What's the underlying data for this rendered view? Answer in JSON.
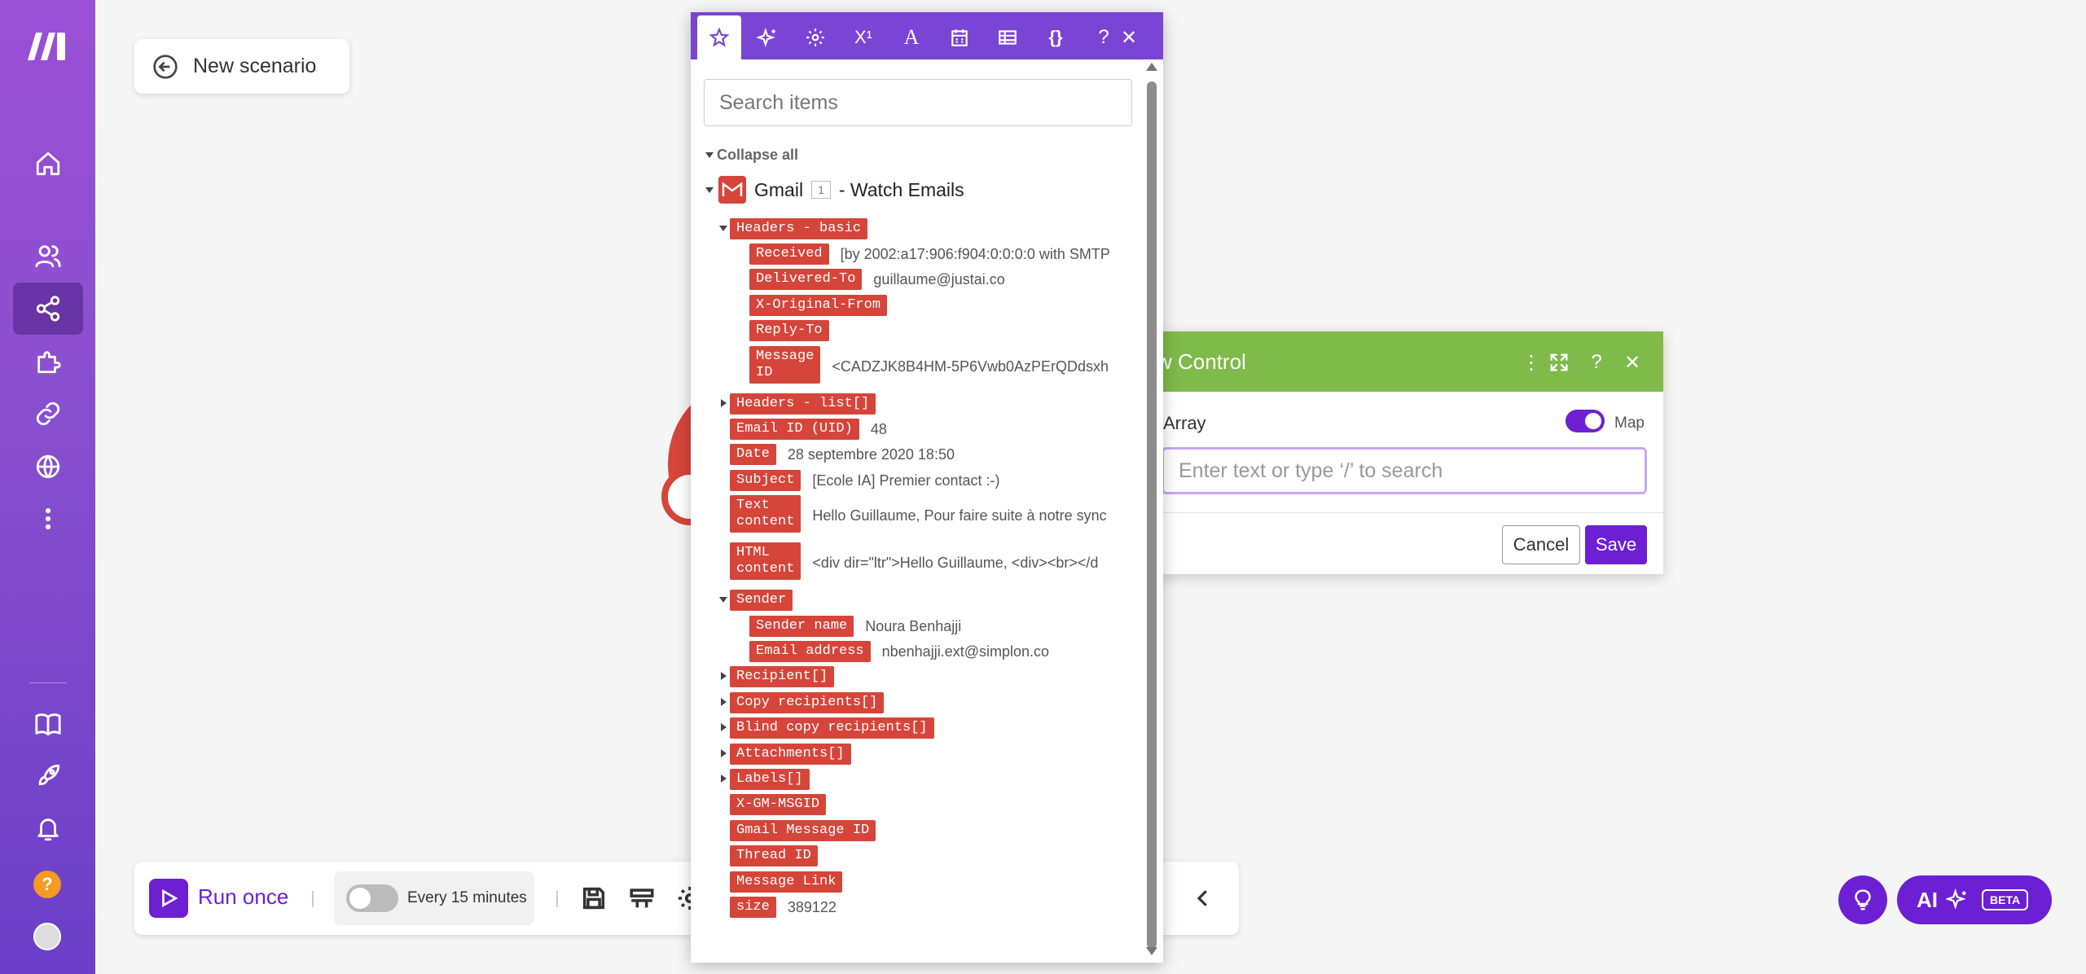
{
  "scenario": {
    "title": "New scenario"
  },
  "sidebar": {
    "items": [
      {
        "icon": "home-icon"
      },
      {
        "icon": "team-icon"
      },
      {
        "icon": "share-icon"
      },
      {
        "icon": "puzzle-icon"
      },
      {
        "icon": "link-icon"
      },
      {
        "icon": "globe-icon"
      },
      {
        "icon": "more-icon"
      },
      {
        "icon": "book-icon"
      },
      {
        "icon": "rocket-icon"
      },
      {
        "icon": "bell-icon"
      }
    ],
    "help": "?"
  },
  "toolbar": {
    "run_label": "Run once",
    "schedule_label": "Every 15 minutes"
  },
  "ai_button": {
    "label": "AI",
    "badge": "BETA"
  },
  "dialog": {
    "title": "w Control",
    "field_label": "Array",
    "map_label": "Map",
    "input_placeholder": "Enter text or type ‘/’ to search",
    "cancel_label": "Cancel",
    "save_label": "Save"
  },
  "panel": {
    "search_placeholder": "Search items",
    "collapse_all": "Collapse all",
    "module_name": "Gmail",
    "module_number": "1",
    "module_action": "- Watch Emails",
    "items": [
      {
        "label": "Headers - basic",
        "value": ""
      },
      {
        "label": "Received",
        "value": "[by 2002:a17:906:f904:0:0:0:0 with SMTP"
      },
      {
        "label": "Delivered-To",
        "value": "guillaume@justai.co"
      },
      {
        "label": "X-Original-From",
        "value": ""
      },
      {
        "label": "Reply-To",
        "value": ""
      },
      {
        "label": "Message\nID",
        "value": "<CADZJK8B4HM-5P6Vwb0AzPErQDdsxh"
      },
      {
        "label": "Headers - list[]",
        "value": ""
      },
      {
        "label": "Email ID (UID)",
        "value": "48"
      },
      {
        "label": "Date",
        "value": "28 septembre 2020 18:50"
      },
      {
        "label": "Subject",
        "value": "[Ecole IA] Premier contact :-)"
      },
      {
        "label": "Text\ncontent",
        "value": "Hello Guillaume, Pour faire suite à notre sync"
      },
      {
        "label": "HTML\ncontent",
        "value": "<div dir=\"ltr\">Hello Guillaume, <div><br></d"
      },
      {
        "label": "Sender",
        "value": ""
      },
      {
        "label": "Sender name",
        "value": "Noura Benhajji"
      },
      {
        "label": "Email address",
        "value": "nbenhajji.ext@simplon.co"
      },
      {
        "label": "Recipient[]",
        "value": ""
      },
      {
        "label": "Copy recipients[]",
        "value": ""
      },
      {
        "label": "Blind copy recipients[]",
        "value": ""
      },
      {
        "label": "Attachments[]",
        "value": ""
      },
      {
        "label": "Labels[]",
        "value": ""
      },
      {
        "label": "X-GM-MSGID",
        "value": ""
      },
      {
        "label": "Gmail Message ID",
        "value": ""
      },
      {
        "label": "Thread ID",
        "value": ""
      },
      {
        "label": "Message Link",
        "value": ""
      },
      {
        "label": "size",
        "value": "389122"
      }
    ]
  },
  "colors": {
    "sidebar_top": "#9b4fd6",
    "accent": "#6d1fd4",
    "panel_header": "#7a44d4",
    "gmail_red": "#d6453a",
    "flow_green": "#7fba4a"
  }
}
